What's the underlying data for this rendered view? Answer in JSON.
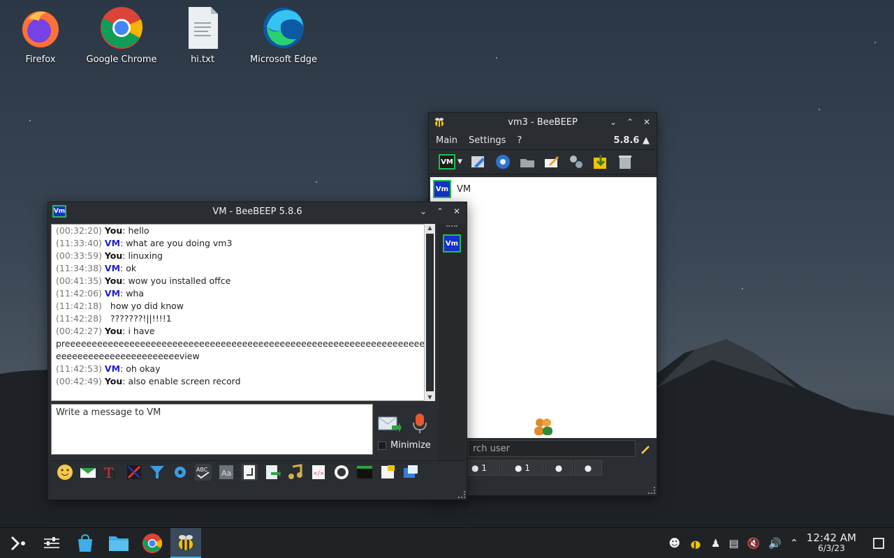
{
  "desktop": {
    "icons": [
      {
        "label": "Firefox"
      },
      {
        "label": "Google Chrome"
      },
      {
        "label": "hi.txt"
      },
      {
        "label": "Microsoft Edge"
      }
    ]
  },
  "chat_window": {
    "title": "VM - BeeBEEP 5.8.6",
    "badge": "Vm",
    "messages": [
      {
        "time": "(00:32:20)",
        "sender": "You",
        "text": ": hello"
      },
      {
        "time": "(11:33:40)",
        "sender": "VM",
        "text": ": what are you doing vm3"
      },
      {
        "time": "(00:33:59)",
        "sender": "You",
        "text": ": linuxing"
      },
      {
        "time": "(11:34:38)",
        "sender": "VM",
        "text": ": ok"
      },
      {
        "time": "(00:41:35)",
        "sender": "You",
        "text": ": wow you installed offce"
      },
      {
        "time": "(11:42:06)",
        "sender": "VM",
        "text": ": wha"
      },
      {
        "time": "(11:42:18)",
        "sender": "",
        "text": "how yo did know"
      },
      {
        "time": "(11:42:28)",
        "sender": "",
        "text": "???????!||!!!!1"
      },
      {
        "time": "(00:42:27)",
        "sender": "You",
        "text": ": i have"
      },
      {
        "time": "",
        "sender": "",
        "text": "preeeeeeeeeeeeeeeeeeeeeeeeeeeeeeeeeeeeeeeeeeeeeeeeeeeeeeeeeeeeeeeeeeeeeeeeee"
      },
      {
        "time": "",
        "sender": "",
        "text": "eeeeeeeeeeeeeeeeeeeeeeeview"
      },
      {
        "time": "(11:42:53)",
        "sender": "VM",
        "text": ": oh okay"
      },
      {
        "time": "(00:42:49)",
        "sender": "You",
        "text": ": also enable screen record"
      }
    ],
    "input_placeholder": "Write a message to VM",
    "minimize_label": "Minimize"
  },
  "main_window": {
    "title": "vm3 - BeeBEEP",
    "menu": [
      "Main",
      "Settings",
      "?"
    ],
    "version": "5.8.6",
    "toolbar_badge": "VM",
    "users": [
      {
        "badge": "Vm",
        "name": "VM"
      }
    ],
    "search_placeholder": "rch user",
    "tabs": [
      {
        "count": "1"
      },
      {
        "count": "1"
      },
      {
        "count": ""
      },
      {
        "count": ""
      }
    ]
  },
  "taskbar": {
    "time": "12:42 AM",
    "date": "6/3/23"
  },
  "colors": {
    "accent": "#3daee9",
    "vm_badge_bg": "#1630c8",
    "vm_badge_border": "#22c04a"
  }
}
